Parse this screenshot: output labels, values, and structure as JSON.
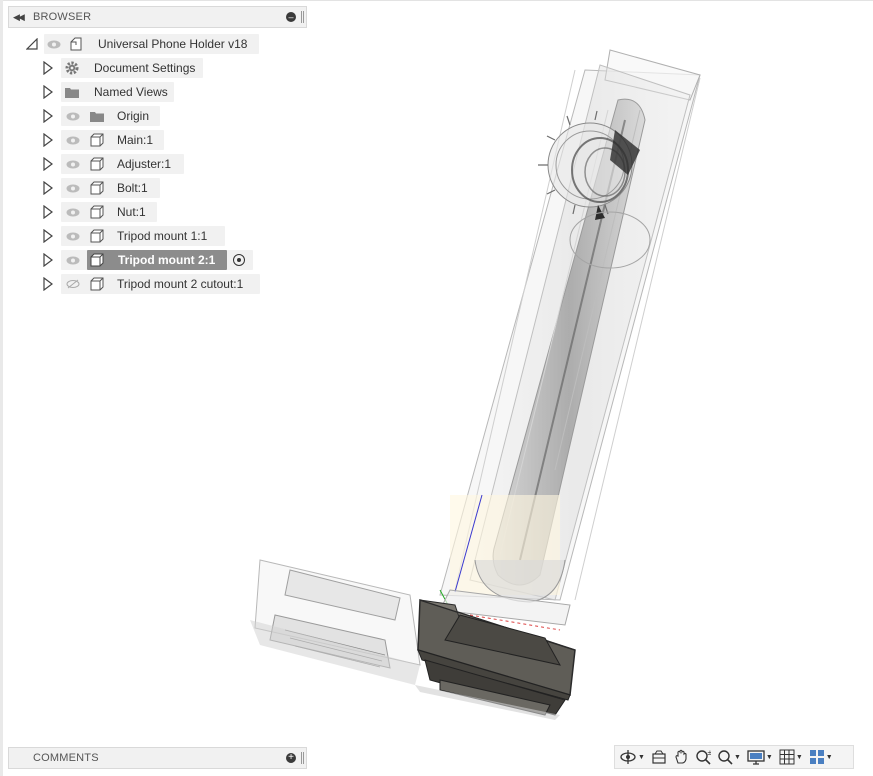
{
  "browser": {
    "title": "BROWSER",
    "root": "Universal Phone Holder v18",
    "items": [
      {
        "label": "Document Settings",
        "icon": "gear-icon",
        "eye": "none"
      },
      {
        "label": "Named Views",
        "icon": "folder-icon",
        "eye": "none"
      },
      {
        "label": "Origin",
        "icon": "folder-icon",
        "eye": "visible"
      },
      {
        "label": "Main:1",
        "icon": "component-icon",
        "eye": "visible"
      },
      {
        "label": "Adjuster:1",
        "icon": "component-icon",
        "eye": "visible"
      },
      {
        "label": "Bolt:1",
        "icon": "component-icon",
        "eye": "visible"
      },
      {
        "label": "Nut:1",
        "icon": "component-icon",
        "eye": "visible"
      },
      {
        "label": "Tripod mount 1:1",
        "icon": "component-icon",
        "eye": "visible"
      },
      {
        "label": "Tripod mount 2:1",
        "icon": "component-icon",
        "eye": "visible",
        "selected": true,
        "active": true
      },
      {
        "label": "Tripod mount 2 cutout:1",
        "icon": "component-icon",
        "eye": "hidden"
      }
    ]
  },
  "comments": {
    "title": "COMMENTS"
  },
  "navbar": {
    "tools": [
      "orbit-icon",
      "look-at-icon",
      "pan-icon",
      "zoom-icon",
      "fit-icon",
      "display-settings-icon",
      "grid-icon",
      "viewports-icon"
    ]
  },
  "colors": {
    "panel_bg": "#f1f1f1",
    "selected_bg": "#8c8c8c",
    "model_dark": "#5c5a55"
  }
}
